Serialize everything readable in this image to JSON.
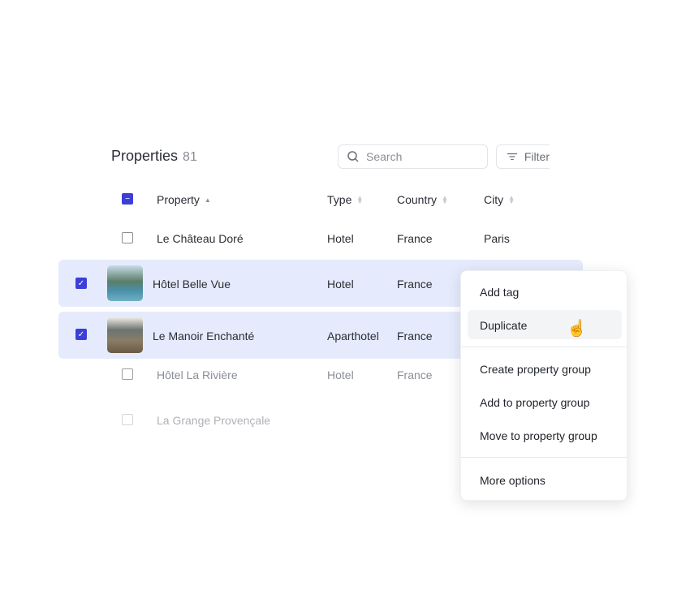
{
  "header": {
    "title": "Properties",
    "count": "81",
    "search_placeholder": "Search",
    "filter_label": "Filter"
  },
  "columns": [
    "Property",
    "Type",
    "Country",
    "City"
  ],
  "rows": [
    {
      "name": "Le Château Doré",
      "type": "Hotel",
      "country": "France",
      "city": "Paris",
      "checked": false
    },
    {
      "name": "Hôtel Belle Vue",
      "type": "Hotel",
      "country": "France",
      "city": "",
      "checked": true
    },
    {
      "name": "Le Manoir Enchanté",
      "type": "Aparthotel",
      "country": "France",
      "city": "",
      "checked": true
    },
    {
      "name": "Hôtel La Rivière",
      "type": "Hotel",
      "country": "France",
      "city": "",
      "checked": false
    },
    {
      "name": "La Grange Provençale",
      "type": "",
      "country": "",
      "city": "",
      "checked": false
    }
  ],
  "menu": {
    "items": [
      "Add tag",
      "Duplicate",
      "Create property group",
      "Add to property group",
      "Move to property group",
      "More options"
    ],
    "hovered": "Duplicate"
  },
  "colors": {
    "accent": "#3b3fd8",
    "selected_row": "#e5ebfc"
  }
}
